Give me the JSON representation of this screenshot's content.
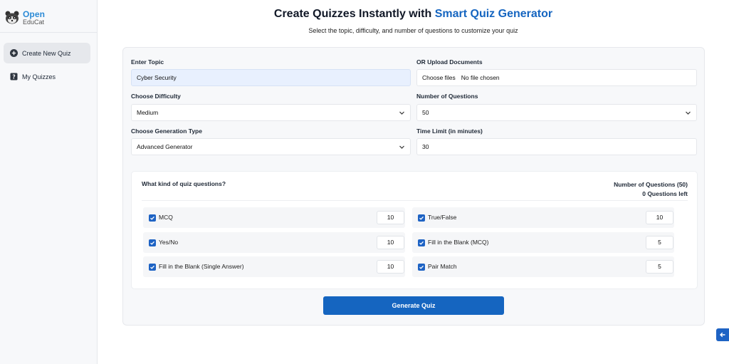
{
  "app": {
    "logo_top": "Open",
    "logo_bottom": "EduCat"
  },
  "sidebar": {
    "items": [
      {
        "label": "Create New Quiz",
        "icon": "plus-circle-icon",
        "active": true
      },
      {
        "label": "My Quizzes",
        "icon": "quiz-book-icon",
        "active": false
      }
    ]
  },
  "header": {
    "title_prefix": "Create Quizzes Instantly with ",
    "title_accent": "Smart Quiz Generator",
    "subtitle": "Select the topic, difficulty, and number of questions to customize your quiz"
  },
  "form": {
    "topic": {
      "label": "Enter Topic",
      "value": "Cyber Security"
    },
    "upload": {
      "label": "OR Upload Documents",
      "button": "Choose files",
      "status": "No file chosen"
    },
    "difficulty": {
      "label": "Choose Difficulty",
      "value": "Medium"
    },
    "num_questions": {
      "label": "Number of Questions",
      "value": "50"
    },
    "generation_type": {
      "label": "Choose Generation Type",
      "value": "Advanced Generator"
    },
    "time_limit": {
      "label": "Time Limit (in minutes)",
      "value": "30"
    }
  },
  "question_types": {
    "title": "What kind of quiz questions?",
    "count_label": "Number of Questions (50)",
    "left_label": "0 Questions left",
    "items": [
      {
        "label": "MCQ",
        "value": "10",
        "checked": true
      },
      {
        "label": "True/False",
        "value": "10",
        "checked": true
      },
      {
        "label": "Yes/No",
        "value": "10",
        "checked": true
      },
      {
        "label": "Fill in the Blank (MCQ)",
        "value": "5",
        "checked": true
      },
      {
        "label": "Fill in the Blank (Single Answer)",
        "value": "10",
        "checked": true
      },
      {
        "label": "Pair Match",
        "value": "5",
        "checked": true
      }
    ]
  },
  "actions": {
    "generate": "Generate Quiz"
  },
  "colors": {
    "accent": "#1565c0",
    "checkbox": "#1e63c4",
    "logo": "#2b8ad6"
  }
}
